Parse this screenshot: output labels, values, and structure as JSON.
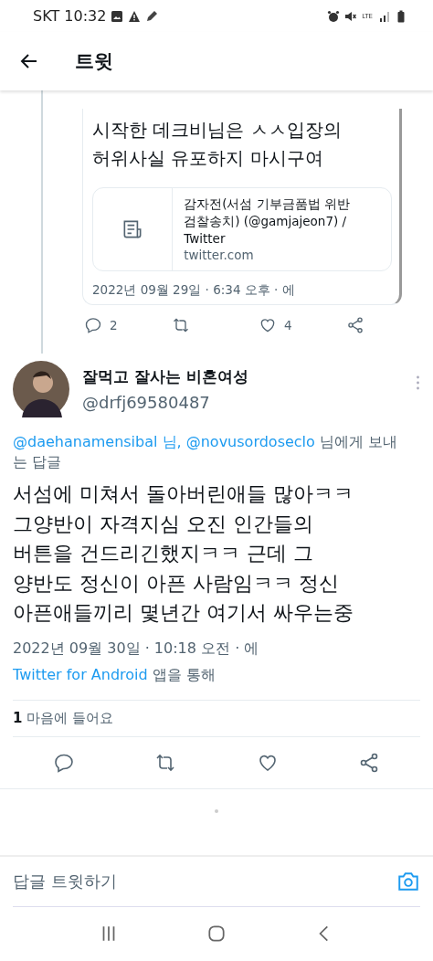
{
  "status_bar": {
    "carrier": "SKT",
    "time": "10:32",
    "network": "LTE"
  },
  "header": {
    "title": "트윗"
  },
  "quoted_tweet": {
    "text_lines": [
      "시작한 데크비님은 ㅅㅅ입장의",
      "허위사실 유포하지 마시구여"
    ],
    "link_card": {
      "title_lines": [
        "감자전(서섬 기부금품법 위반",
        "검찰송치) (@gamjajeon7) / Twitter"
      ],
      "domain": "twitter.com"
    },
    "timestamp": "2022년 09월 29일 · 6:34 오후 · 에",
    "actions": [
      {
        "kind": "reply",
        "count": "2"
      },
      {
        "kind": "retweet"
      },
      {
        "kind": "like",
        "count": "4"
      },
      {
        "kind": "share"
      }
    ]
  },
  "tweet": {
    "display_name": "잘먹고 잘사는 비혼여성",
    "handle": "@drfj69580487",
    "reply_to": [
      {
        "kind": "mention",
        "text": "@daehanamensibal 님,"
      },
      {
        "kind": "mention",
        "text": "@novusordoseclo"
      },
      {
        "kind": "plain",
        "text": "님에게 보내는 답글"
      }
    ],
    "text_lines": [
      "서섬에 미쳐서 돌아버린애들 많아ㅋㅋ",
      "그양반이 자격지심 오진 인간들의",
      "버튼을 건드리긴했지ㅋㅋ 근데 그",
      "양반도 정신이 아픈 사람임ㅋㅋ 정신",
      "아픈애들끼리 몇년간 여기서 싸우는중"
    ],
    "timestamp": "2022년 09월 30일 · 10:18 오전 · 에",
    "source": "Twitter for Android",
    "source_suffix": "앱을 통해",
    "likes_count": "1",
    "likes_label": "마음에 들어요",
    "actions": [
      {
        "kind": "reply"
      },
      {
        "kind": "retweet"
      },
      {
        "kind": "like"
      },
      {
        "kind": "share"
      }
    ]
  },
  "reply_bar": {
    "placeholder": "답글 트윗하기"
  }
}
